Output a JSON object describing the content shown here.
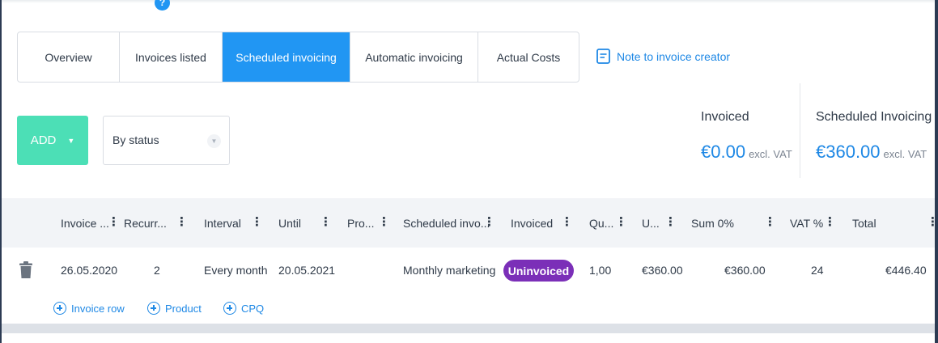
{
  "tabs": [
    {
      "label": "Overview",
      "active": false
    },
    {
      "label": "Invoices listed",
      "active": false
    },
    {
      "label": "Scheduled invoicing",
      "active": true
    },
    {
      "label": "Automatic invoicing",
      "active": false
    },
    {
      "label": "Actual Costs",
      "active": false
    }
  ],
  "note_link": {
    "label": "Note to invoice creator",
    "icon": "note-icon"
  },
  "help_icon": {
    "glyph": "?"
  },
  "toolbar": {
    "add_label": "ADD",
    "status_select_value": "By status"
  },
  "summary": {
    "invoiced": {
      "label": "Invoiced",
      "amount": "€0.00",
      "suffix": "excl. VAT"
    },
    "scheduled": {
      "label": "Scheduled Invoicing",
      "amount": "€360.00",
      "suffix": "excl. VAT"
    }
  },
  "table": {
    "columns": [
      "Invoice ...",
      "Recurr...",
      "Interval",
      "Until",
      "Pro...",
      "Scheduled invo...",
      "Invoiced",
      "Qu...",
      "U...",
      "Sum 0%",
      "VAT %",
      "Total"
    ],
    "rows": [
      {
        "invoice_date": "26.05.2020",
        "recurrences": "2",
        "interval": "Every month",
        "until": "20.05.2021",
        "product": "",
        "scheduled_invoice": "Monthly marketing re",
        "invoiced_status": "Uninvoiced",
        "quantity": "1,00",
        "unit_price": "€360.00",
        "sum": "€360.00",
        "vat": "24",
        "total": "€446.40"
      }
    ]
  },
  "row_actions": [
    {
      "label": "Invoice row"
    },
    {
      "label": "Product"
    },
    {
      "label": "CPQ"
    }
  ],
  "colors": {
    "primary": "#2196f3",
    "add_button": "#4cdfb6",
    "status_badge": "#7b2fb8",
    "link": "#1e88e5"
  }
}
